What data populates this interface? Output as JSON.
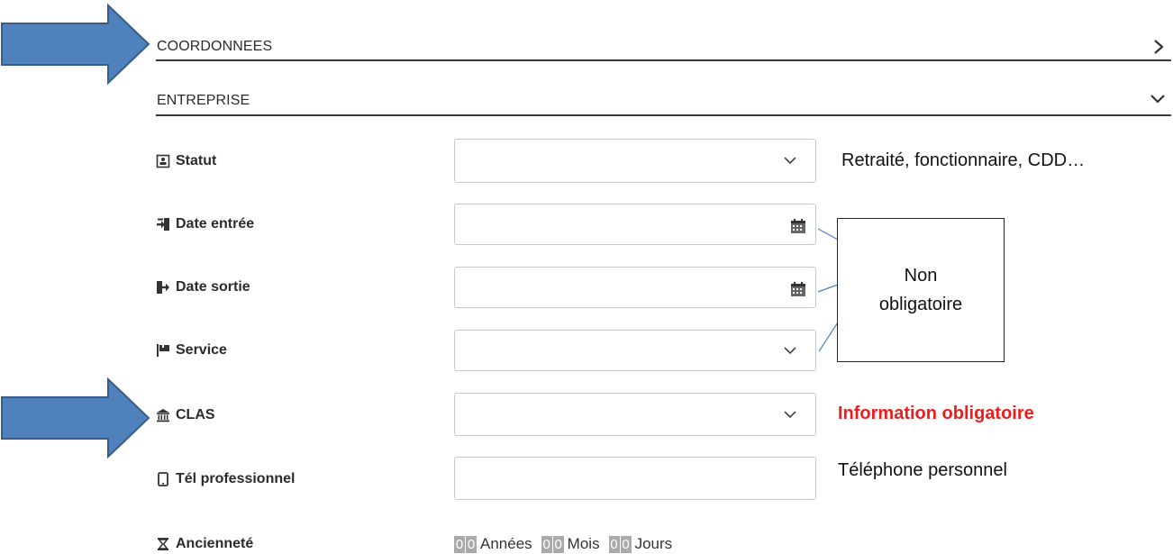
{
  "sections": {
    "coordonnees": {
      "title": "COORDONNEES",
      "expanded": false,
      "icon": "chevron-right-icon"
    },
    "entreprise": {
      "title": "ENTREPRISE",
      "expanded": true,
      "icon": "chevron-down-icon"
    }
  },
  "fields": {
    "statut": {
      "label": "Statut",
      "icon": "id-card-icon",
      "value": "",
      "type": "select"
    },
    "date_entree": {
      "label": "Date entrée",
      "icon": "sign-in-icon",
      "value": "",
      "type": "date"
    },
    "date_sortie": {
      "label": "Date sortie",
      "icon": "sign-out-icon",
      "value": "",
      "type": "date"
    },
    "service": {
      "label": "Service",
      "icon": "flag-icon",
      "value": "",
      "type": "select"
    },
    "clas": {
      "label": "CLAS",
      "icon": "institution-icon",
      "value": "",
      "type": "select"
    },
    "tel_pro": {
      "label": "Tél professionnel",
      "icon": "mobile-phone-icon",
      "value": "",
      "type": "text"
    },
    "anciennete": {
      "label": "Ancienneté",
      "icon": "hourglass-icon",
      "annees_digits": [
        "0",
        "0"
      ],
      "annees_unit": "Années",
      "mois_digits": [
        "0",
        "0"
      ],
      "mois_unit": "Mois",
      "jours_digits": [
        "0",
        "0"
      ],
      "jours_unit": "Jours"
    }
  },
  "annotations": {
    "statut_note": "Retraité, fonctionnaire, CDD…",
    "callout_line1": "Non",
    "callout_line2": "obligatoire",
    "clas_note": "Information obligatoire",
    "tel_note": "Téléphone personnel"
  },
  "colors": {
    "arrow_fill": "#4f81bd",
    "arrow_stroke": "#385d8a",
    "required_red": "#ee1c1c",
    "digit_bg": "#aaaaaa",
    "callout_line": "#4f81bd"
  }
}
